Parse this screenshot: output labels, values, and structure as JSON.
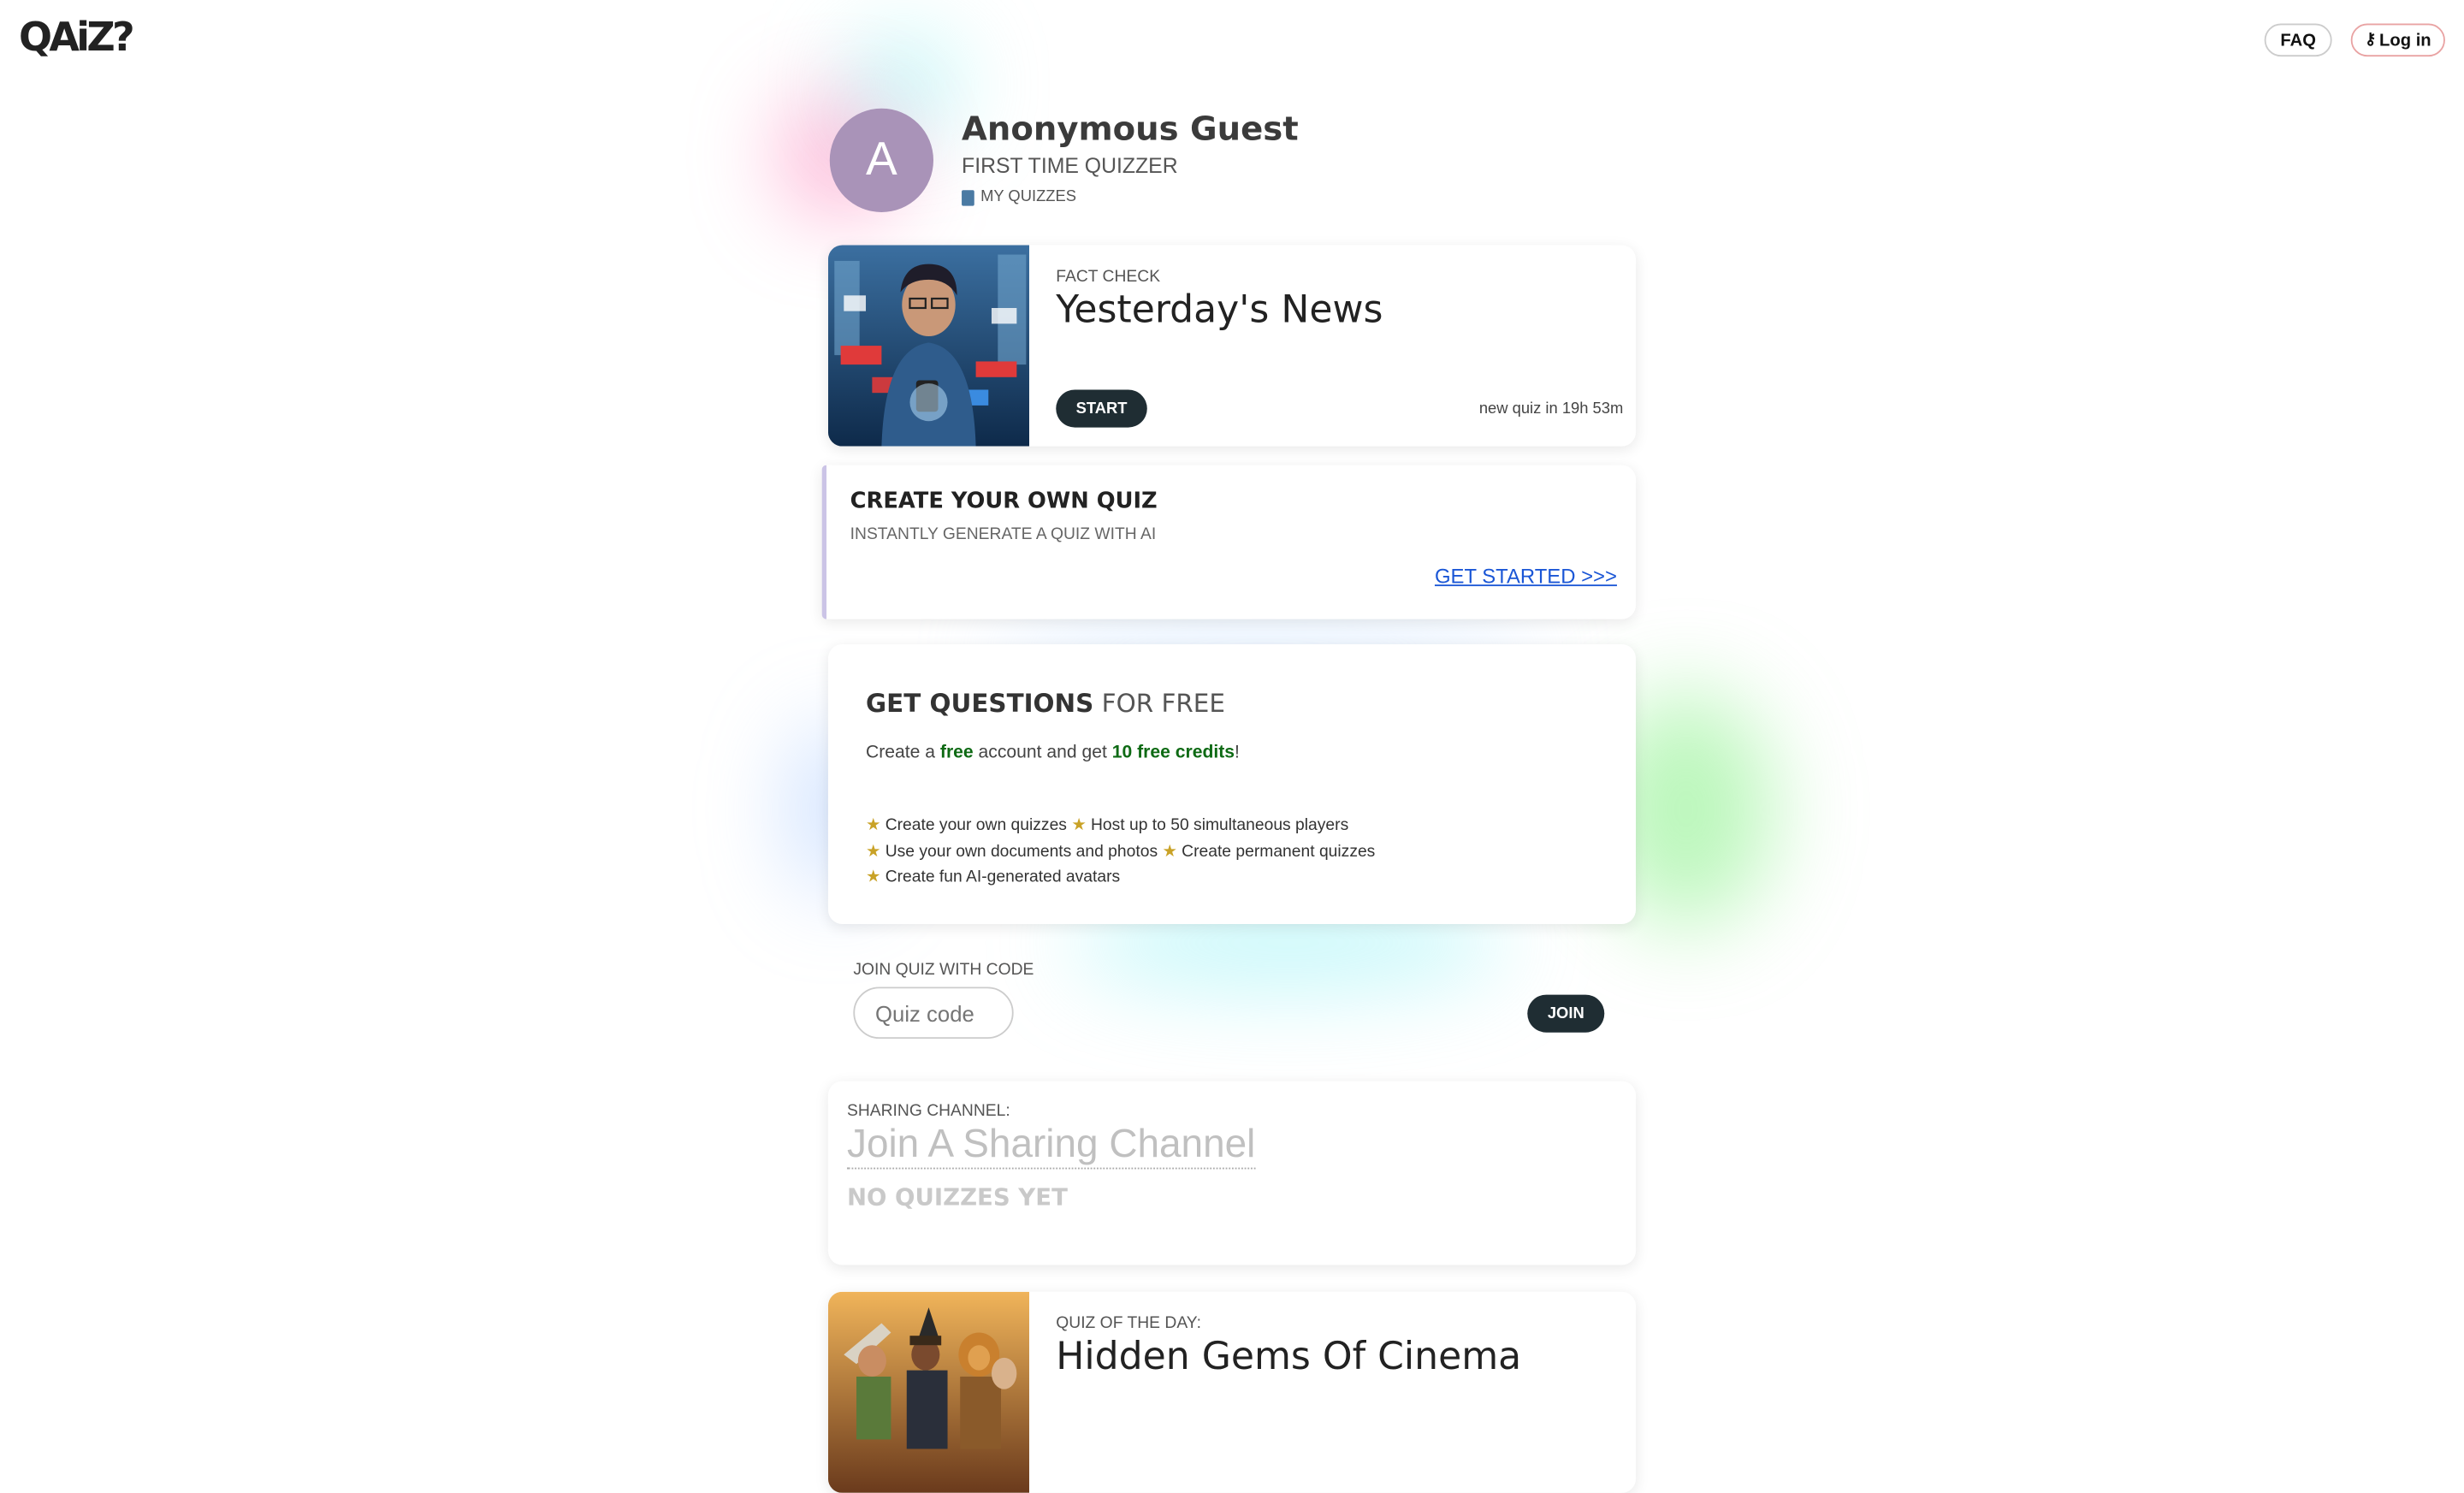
{
  "header": {
    "logo": "QAiZ?",
    "faq_label": "FAQ",
    "login_label": "Log in"
  },
  "profile": {
    "initial": "A",
    "name": "Anonymous Guest",
    "rank": "FIRST TIME QUIZZER",
    "my_quizzes": "MY QUIZZES"
  },
  "fact_check": {
    "category": "FACT CHECK",
    "title": "Yesterday's News",
    "start_label": "START",
    "timer": "new quiz in 19h 53m"
  },
  "create_quiz": {
    "title": "CREATE YOUR OWN QUIZ",
    "subtitle": "INSTANTLY GENERATE A QUIZ WITH AI",
    "link": "GET STARTED >>>"
  },
  "free_questions": {
    "title_bold": "GET QUESTIONS",
    "title_rest": "FOR FREE",
    "intro_1": "Create a ",
    "intro_free": "free",
    "intro_2": " account and get ",
    "intro_credits": "10 free credits",
    "intro_3": "!",
    "perks": [
      "Create your own quizzes",
      "Host up to 50 simultaneous players",
      "Use your own documents and photos",
      "Create permanent quizzes",
      "Create fun AI-generated avatars"
    ]
  },
  "join": {
    "label": "JOIN QUIZ WITH CODE",
    "placeholder": "Quiz code",
    "button": "JOIN"
  },
  "sharing": {
    "label": "SHARING CHANNEL:",
    "channel": "Join A Sharing Channel",
    "empty": "NO QUIZZES YET"
  },
  "quiz_of_day": {
    "category": "QUIZ OF THE DAY:",
    "title": "Hidden Gems Of Cinema"
  },
  "colors": {
    "accent_dark": "#1f2d33",
    "link": "#1a56d6",
    "credits_green": "#0e6a14",
    "star": "#c9a227"
  }
}
